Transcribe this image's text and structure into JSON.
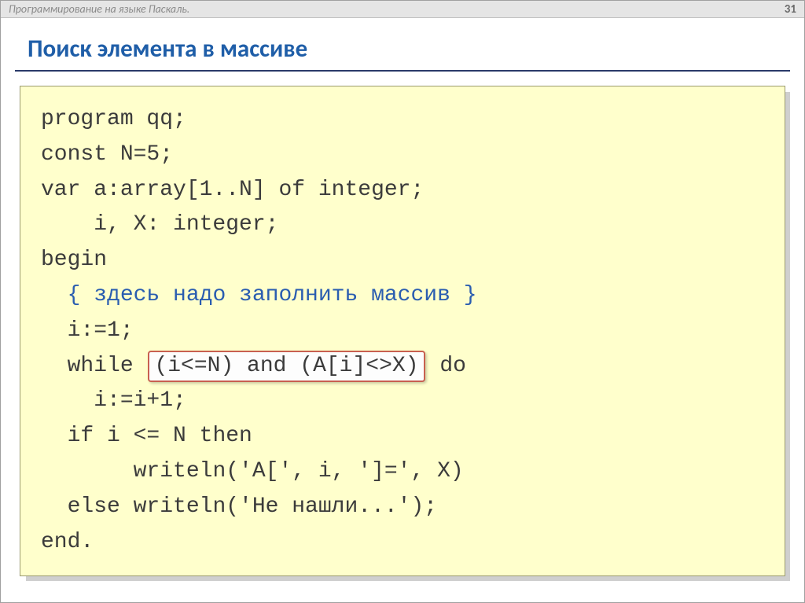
{
  "topbar": {
    "course_title": "Программирование на языке Паскаль.",
    "page_number": "31"
  },
  "heading": "Поиск элемента в массиве",
  "code": {
    "l1": "program qq;",
    "l2": "const N=5;",
    "l3": "var a:array[1..N] of integer;",
    "l4": "    i, X: integer;",
    "l5": "begin",
    "comment": "{ здесь надо заполнить массив }",
    "l7": "i:=1;",
    "l8a": "while",
    "highlight": "(i<=N) and (A[i]<>X)",
    "l8b": "do",
    "l9": "i:=i+1;",
    "l10": "if i <= N then",
    "l11": "writeln('A[', i, ']=', X)",
    "l12": "else writeln('Не нашли...');",
    "l13": "end."
  }
}
